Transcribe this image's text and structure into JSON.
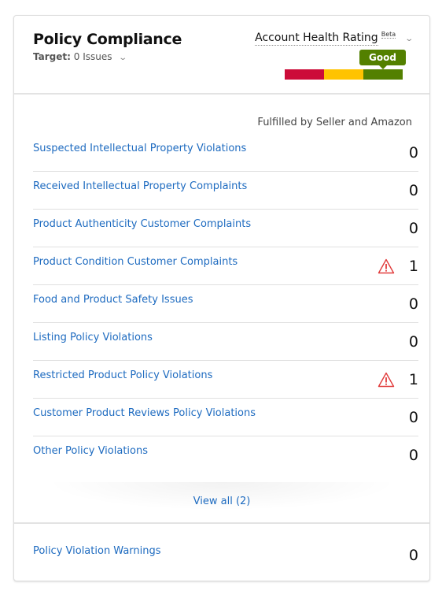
{
  "header": {
    "title": "Policy Compliance",
    "target_label": "Target:",
    "target_value": "0 Issues",
    "account_health_label": "Account Health Rating",
    "beta_label": "Beta",
    "rating_status": "Good",
    "rating_level": "good",
    "rating_segments": [
      "poor",
      "fair",
      "good"
    ]
  },
  "colors": {
    "link": "#1e6bc0",
    "poor": "#cc0c39",
    "fair": "#ffc300",
    "good": "#538000",
    "warning": "#e13b3b"
  },
  "icons": {
    "chevron": "chevron-down-icon",
    "warning": "warning-triangle-icon"
  },
  "fulfillment_label": "Fulfilled by Seller and Amazon",
  "violations": [
    {
      "label": "Suspected Intellectual Property Violations",
      "count": "0",
      "warning": false
    },
    {
      "label": "Received Intellectual Property Complaints",
      "count": "0",
      "warning": false
    },
    {
      "label": "Product Authenticity Customer Complaints",
      "count": "0",
      "warning": false
    },
    {
      "label": "Product Condition Customer Complaints",
      "count": "1",
      "warning": true
    },
    {
      "label": "Food and Product Safety Issues",
      "count": "0",
      "warning": false
    },
    {
      "label": "Listing Policy Violations",
      "count": "0",
      "warning": false
    },
    {
      "label": "Restricted Product Policy Violations",
      "count": "1",
      "warning": true
    },
    {
      "label": "Customer Product Reviews Policy Violations",
      "count": "0",
      "warning": false
    },
    {
      "label": "Other Policy Violations",
      "count": "0",
      "warning": false
    }
  ],
  "view_all_label": "View all (2)",
  "policy_warnings": {
    "label": "Policy Violation Warnings",
    "count": "0"
  }
}
